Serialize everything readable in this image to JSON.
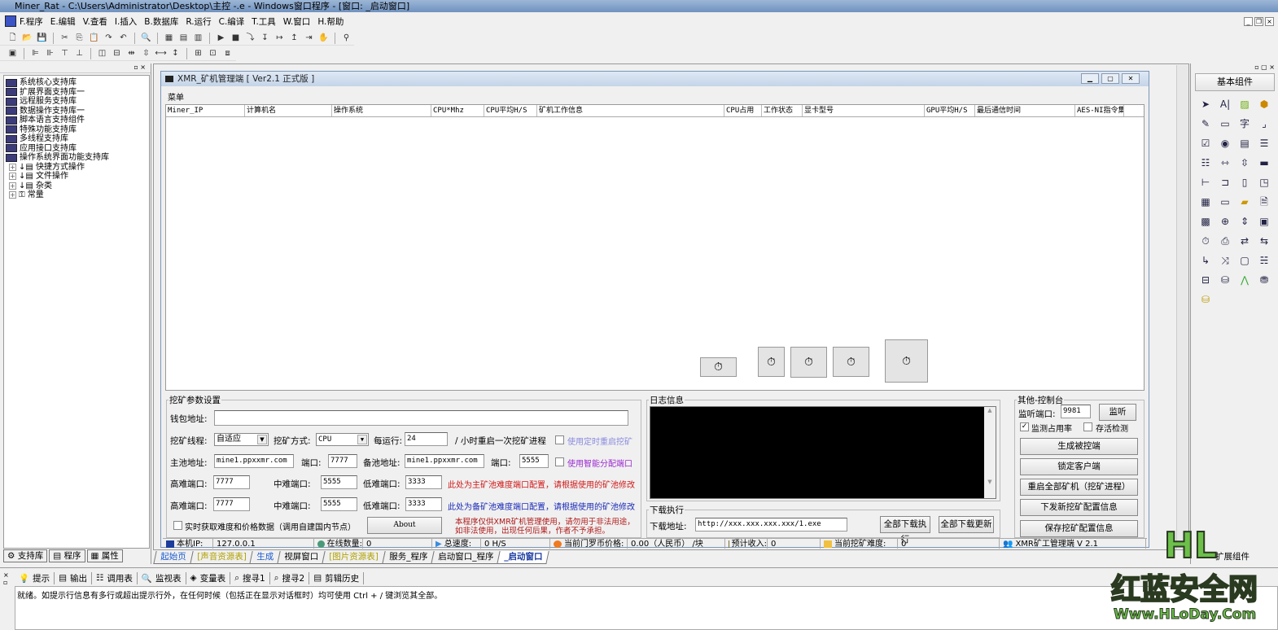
{
  "window": {
    "title": "Miner_Rat - C:\\Users\\Administrator\\Desktop\\主控 -.e - Windows窗口程序 - [窗口: _启动窗口]"
  },
  "menu": [
    "F.程序",
    "E.编辑",
    "V.查看",
    "I.插入",
    "B.数据库",
    "R.运行",
    "C.编译",
    "T.工具",
    "W.窗口",
    "H.帮助"
  ],
  "left_panel": {
    "libraries": [
      "系统核心支持库",
      "扩展界面支持库一",
      "远程服务支持库",
      "数据操作支持库一",
      "脚本语言支持组件",
      "特殊功能支持库",
      "多线程支持库",
      "应用接口支持库",
      "操作系统界面功能支持库"
    ],
    "groups": [
      "快捷方式操作",
      "文件操作",
      "杂类",
      "常量"
    ],
    "tabs": [
      "支持库",
      "程序",
      "属性"
    ]
  },
  "form": {
    "title": "XMR_矿机管理端 [ Ver2.1 正式版 ]",
    "menu": "菜单",
    "columns": [
      "Miner_IP",
      "计算机名",
      "操作系统",
      "CPU*Mhz",
      "CPU平均H/S",
      "矿机工作信息",
      "CPU占用",
      "工作状态",
      "显卡型号",
      "GPU平均H/S",
      "最后通信时间",
      "AES-NI指令集"
    ],
    "params": {
      "legend": "挖矿参数设置",
      "wallet_label": "钱包地址:",
      "wallet_value": "",
      "threads_label": "挖矿线程:",
      "threads_value": "自适应",
      "mode_label": "挖矿方式:",
      "mode_value": "CPU",
      "every_label": "每运行:",
      "every_value": "24",
      "every_suffix": "/ 小时重启一次挖矿进程",
      "timed_restart": "使用定时重启挖矿",
      "main_pool_label": "主池地址:",
      "main_pool_value": "mine1.ppxxmr.com",
      "port_label": "端口:",
      "main_port": "7777",
      "backup_pool_label": "备池地址:",
      "backup_pool_value": "mine1.ppxxmr.com",
      "backup_port": "5555",
      "smart_port": "使用智能分配端口",
      "high_label": "高难端口:",
      "mid_label": "中难端口:",
      "low_label": "低难端口:",
      "row1": {
        "high": "7777",
        "mid": "5555",
        "low": "3333",
        "note": "此处为主矿池难度端口配置，请根据使用的矿池修改"
      },
      "row2": {
        "high": "7777",
        "mid": "5555",
        "low": "3333",
        "note": "此处为备矿池难度端口配置，请根据使用的矿池修改"
      },
      "realtime": "实时获取难度和价格数据（调用自建国内节点）",
      "about": "About",
      "disclaimer1": "本程序仅供XMR矿机管理使用，请勿用于非法用途，",
      "disclaimer2": "如非法使用，出现任何后果，作者不予承担。"
    },
    "log": {
      "legend": "日志信息"
    },
    "download": {
      "legend": "下载执行",
      "label": "下载地址:",
      "value": "http://xxx.xxx.xxx.xxx/1.exe",
      "exec_all": "全部下载执行",
      "update_all": "全部下载更新"
    },
    "console": {
      "legend": "其他-控制台",
      "listen_label": "监听端口:",
      "listen_port": "9981",
      "listen_btn": "监听",
      "monitor_usage": "监测占用率",
      "alive_check": "存活检测",
      "buttons": [
        "生成被控端",
        "锁定客户端",
        "重启全部矿机（挖矿进程）",
        "下发新挖矿配置信息",
        "保存挖矿配置信息"
      ]
    },
    "status": {
      "ip_label": "本机IP:",
      "ip_value": "127.0.0.1",
      "online_label": "在线数量:",
      "online_value": "0",
      "speed_label": "总速度:",
      "speed_value": "0 H/S",
      "price_label": "当前门罗币价格:",
      "price_value": "0.00（人民币） /块",
      "income_label": "预计收入:",
      "income_value": "0",
      "difficulty_label": "当前挖矿难度:",
      "difficulty_value": "0",
      "version": "XMR矿工管理端 V 2.1"
    }
  },
  "doc_tabs": [
    "起始页",
    "[声音资源表]",
    "生成",
    "视屏窗口",
    "[图片资源表]",
    "服务_程序",
    "启动窗口_程序",
    "_启动窗口"
  ],
  "right_panel": {
    "title": "基本组件",
    "footer": "扩展组件"
  },
  "bottom": {
    "tabs": [
      "提示",
      "输出",
      "调用表",
      "监视表",
      "变量表",
      "搜寻1",
      "搜寻2",
      "剪辑历史"
    ],
    "hint": "就绪。如提示行信息有多行或超出提示行外，在任何时候（包括正在显示对话框时）均可使用 Ctrl + / 键浏览其全部。"
  },
  "watermark": {
    "line1": "HL",
    "line2": "红蓝安全网",
    "line3": "Www.HLoDay.Com"
  }
}
